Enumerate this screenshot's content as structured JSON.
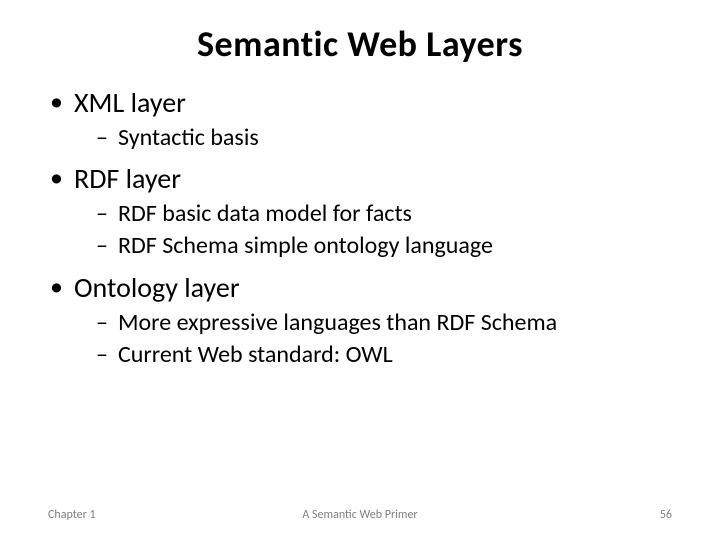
{
  "title": "Semantic Web Layers",
  "bullets": [
    {
      "label": "XML layer",
      "sub": [
        "Syntactic basis"
      ]
    },
    {
      "label": "RDF layer",
      "sub": [
        "RDF basic data model for facts",
        "RDF Schema simple ontology language"
      ]
    },
    {
      "label": "Ontology layer",
      "sub": [
        "More expressive languages than RDF Schema",
        "Current Web standard: OWL"
      ]
    }
  ],
  "footer": {
    "left": "Chapter 1",
    "center": "A Semantic Web Primer",
    "right": "56"
  }
}
